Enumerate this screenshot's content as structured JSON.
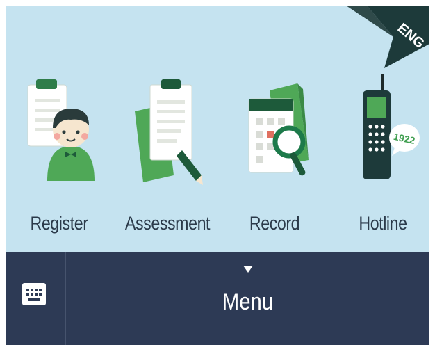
{
  "lang_toggle": "ENG",
  "menu_items": [
    {
      "label": "Register",
      "icon": "register-icon"
    },
    {
      "label": "Assessment",
      "icon": "assessment-icon"
    },
    {
      "label": "Record",
      "icon": "record-icon"
    },
    {
      "label": "Hotline",
      "icon": "hotline-icon",
      "badge": "1922"
    }
  ],
  "bottom_bar": {
    "menu_label": "Menu",
    "keyboard_icon": "keyboard-icon"
  },
  "colors": {
    "panel_bg": "#c5e3f0",
    "bar_bg": "#2d3a55",
    "accent_green": "#3f9e4f",
    "dark_green": "#1d5a3a"
  }
}
